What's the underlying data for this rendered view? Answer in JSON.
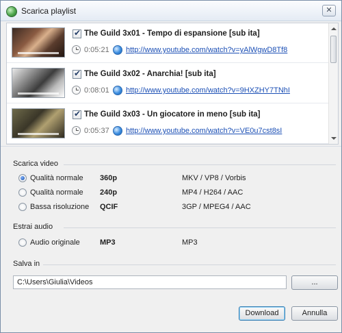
{
  "window": {
    "title": "Scarica playlist",
    "close_label": "✕"
  },
  "playlist": [
    {
      "title": "The Guild 3x01 - Tempo di espansione [sub ita]",
      "checked": true,
      "duration": "0:05:21",
      "url": "http://www.youtube.com/watch?v=yAlWgwD8Tf8"
    },
    {
      "title": "The Guild 3x02 - Anarchia! [sub ita]",
      "checked": true,
      "duration": "0:08:01",
      "url": "http://www.youtube.com/watch?v=9HXZHY7TNhI"
    },
    {
      "title": "The Guild 3x03 - Un giocatore in meno [sub ita]",
      "checked": true,
      "duration": "0:05:37",
      "url": "http://www.youtube.com/watch?v=VE0u7cst8sI"
    }
  ],
  "video": {
    "section_label": "Scarica video",
    "options": [
      {
        "quality": "Qualità normale",
        "resolution": "360p",
        "format": "MKV / VP8 / Vorbis",
        "selected": true
      },
      {
        "quality": "Qualità normale",
        "resolution": "240p",
        "format": "MP4 / H264 / AAC",
        "selected": false
      },
      {
        "quality": "Bassa risoluzione",
        "resolution": "QCIF",
        "format": "3GP / MPEG4 / AAC",
        "selected": false
      }
    ]
  },
  "audio": {
    "section_label": "Estrai audio",
    "options": [
      {
        "quality": "Audio originale",
        "resolution": "MP3",
        "format": "MP3",
        "selected": false
      }
    ]
  },
  "save": {
    "section_label": "Salva in",
    "path": "C:\\Users\\Giulia\\Videos",
    "browse_label": "..."
  },
  "buttons": {
    "download_label": "Download",
    "cancel_label": "Annulla"
  },
  "colors": {
    "link": "#1b4fb5",
    "accent": "#3c7fb1"
  }
}
